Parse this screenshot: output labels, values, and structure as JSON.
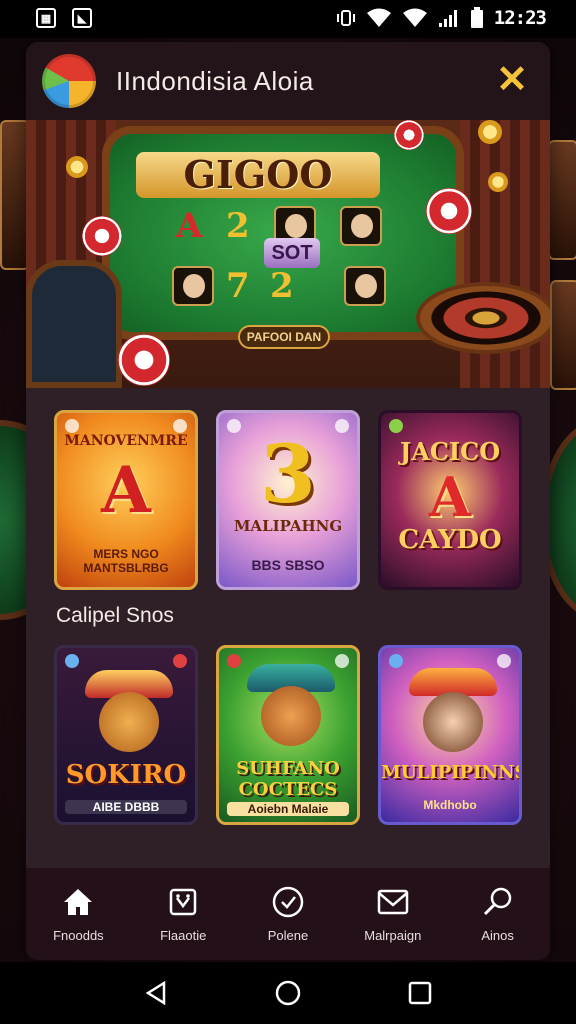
{
  "status_bar": {
    "time": "12:23",
    "left_icons": [
      "app-notification-icon",
      "image-notification-icon"
    ],
    "right_icons": [
      "vibrate-icon",
      "wifi-icon",
      "wifi-icon",
      "signal-icon",
      "battery-icon"
    ]
  },
  "header": {
    "title": "IIndondisia Aloia"
  },
  "hero": {
    "logo_text": "GIGOO",
    "slot_text": "SOT",
    "pill_text": "PAFOOI DAN",
    "cards": [
      "A",
      "2",
      "7",
      "2"
    ]
  },
  "games_row_1": [
    {
      "glyph": "A",
      "title": "MANOVENMRE",
      "subtitle": "MERS NGO MANTSBLRBG"
    },
    {
      "glyph": "3",
      "title": "MALIPAHNG",
      "subtitle": "BBS SBSO"
    },
    {
      "glyph": "A",
      "title": "JACICO",
      "subtitle": "CAYDO"
    }
  ],
  "section_title": "Calipel Snos",
  "games_row_2": [
    {
      "title": "SOKIRO",
      "subtitle": "AIBE DBBB"
    },
    {
      "title": "SUHFANO COCTECS",
      "subtitle": "Aoiebn Malaie"
    },
    {
      "title": "MULIPIPINNS",
      "subtitle": "Mkdhobo"
    }
  ],
  "bottom_nav": [
    {
      "label": "Fnoodds",
      "icon": "home-icon"
    },
    {
      "label": "Flaaotie",
      "icon": "cards-icon"
    },
    {
      "label": "Polene",
      "icon": "clock-icon"
    },
    {
      "label": "Malrpaign",
      "icon": "mail-icon"
    },
    {
      "label": "Ainos",
      "icon": "search-icon"
    }
  ],
  "colors": {
    "accent": "#f6c43a",
    "panel": "#2f1f26",
    "nav_bg": "#241018"
  }
}
